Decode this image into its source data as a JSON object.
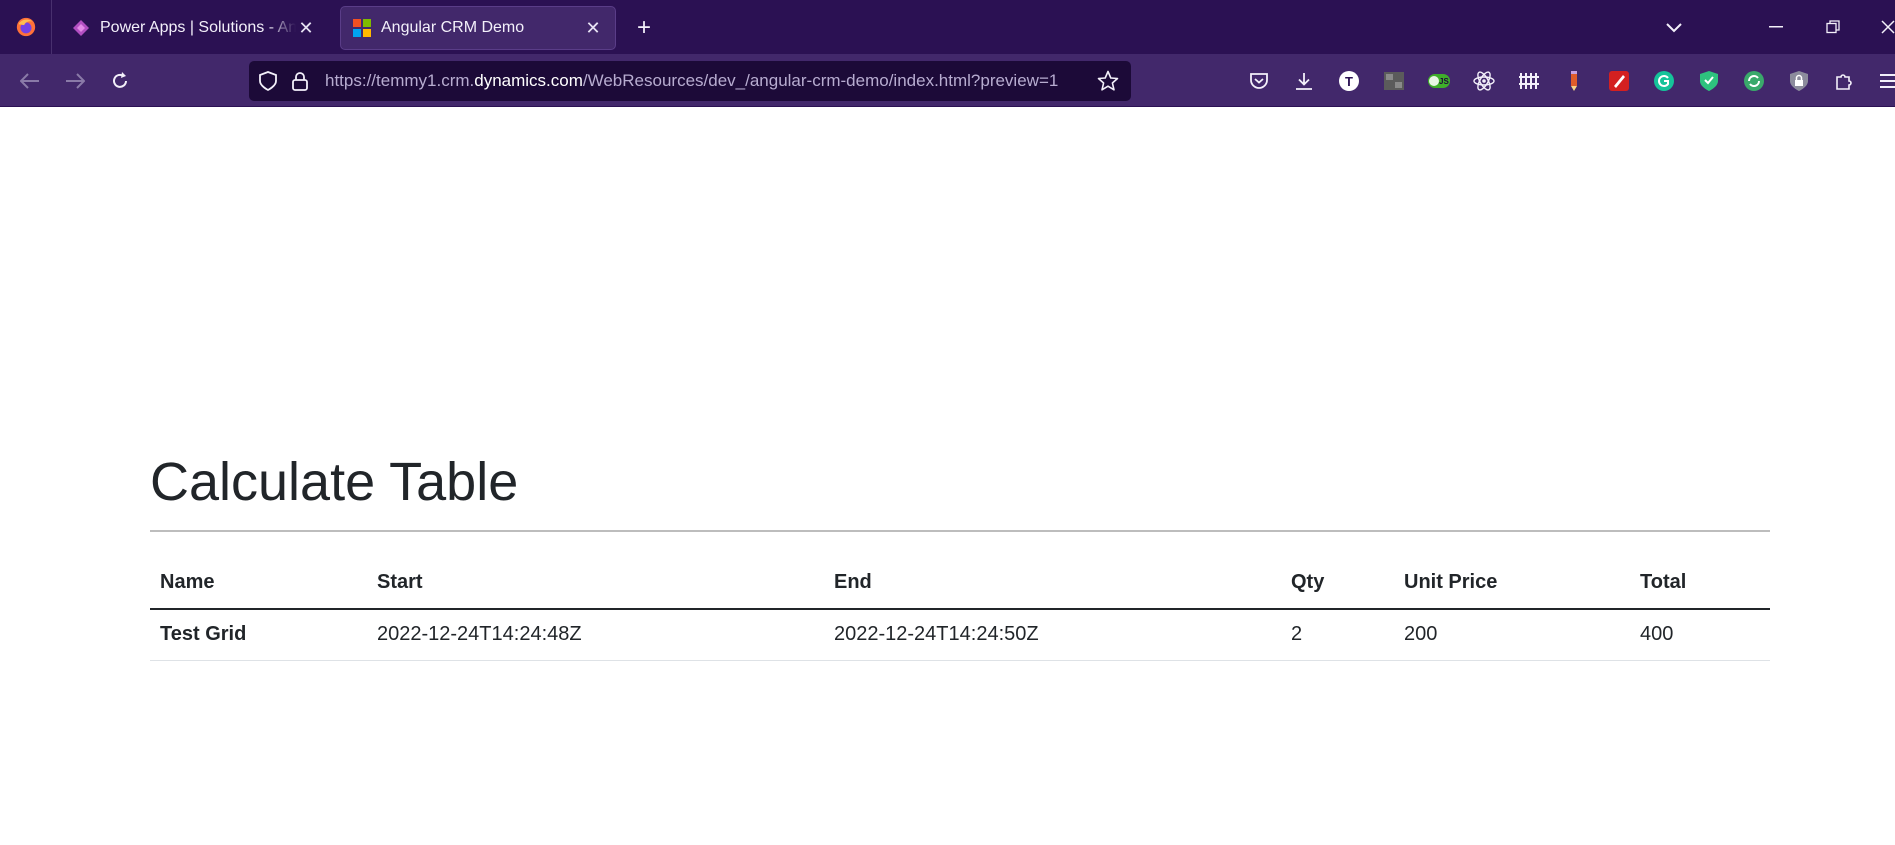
{
  "browser": {
    "tabs": [
      {
        "title": "Power Apps | Solutions - Angular CRM Demo",
        "active": false,
        "favicon": "power-apps-icon"
      },
      {
        "title": "Angular CRM Demo",
        "active": true,
        "favicon": "microsoft-icon"
      }
    ],
    "url": {
      "prefix": "https://temmy1.crm.",
      "domain": "dynamics.com",
      "path": "/WebResources/dev_/angular-crm-demo/index.html?preview=1"
    },
    "extension_labels": {
      "t_badge": "T",
      "js_badge": "JS"
    },
    "colors": {
      "tabstrip_bg": "#2b1153",
      "navbar_bg": "#42286b",
      "urlbar_bg": "#1c0a38"
    }
  },
  "page": {
    "heading": "Calculate Table",
    "table": {
      "columns": [
        "Name",
        "Start",
        "End",
        "Qty",
        "Unit Price",
        "Total"
      ],
      "rows": [
        [
          "Test Grid",
          "2022-12-24T14:24:48Z",
          "2022-12-24T14:24:50Z",
          "2",
          "200",
          "400"
        ]
      ]
    }
  }
}
